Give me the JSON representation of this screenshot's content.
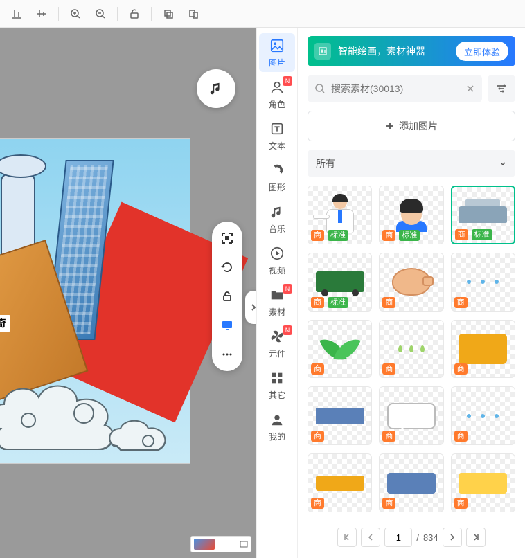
{
  "toolbar": {
    "icons": [
      "align-bottom",
      "align-middle",
      "zoom-in",
      "zoom-out",
      "unlock",
      "copy",
      "paste"
    ]
  },
  "canvas": {
    "caption": "写传奇",
    "music_icon": "music-note",
    "tools": [
      "focus",
      "rotate",
      "lock",
      "display",
      "more"
    ]
  },
  "sidetabs": [
    {
      "key": "image",
      "label": "图片",
      "icon": "image",
      "active": true
    },
    {
      "key": "role",
      "label": "角色",
      "icon": "person",
      "badge": "N"
    },
    {
      "key": "text",
      "label": "文本",
      "icon": "text"
    },
    {
      "key": "shape",
      "label": "图形",
      "icon": "shape"
    },
    {
      "key": "music",
      "label": "音乐",
      "icon": "music"
    },
    {
      "key": "video",
      "label": "视频",
      "icon": "play"
    },
    {
      "key": "material",
      "label": "素材",
      "icon": "folder",
      "badge": "N"
    },
    {
      "key": "component",
      "label": "元件",
      "icon": "pinwheel",
      "badge": "N"
    },
    {
      "key": "other",
      "label": "其它",
      "icon": "grid"
    },
    {
      "key": "mine",
      "label": "我的",
      "icon": "user"
    }
  ],
  "panel": {
    "promo_text": "智能绘画，素材神器",
    "promo_btn": "立即体验",
    "search_placeholder": "搜索素材(30013)",
    "add_label": "添加图片",
    "category_label": "所有",
    "tags": {
      "commercial": "商",
      "standard": "标准"
    },
    "assets": [
      {
        "kind": "doctor",
        "com": true,
        "std": true
      },
      {
        "kind": "head",
        "com": true,
        "std": true
      },
      {
        "kind": "ship",
        "com": true,
        "std": true,
        "selected": true
      },
      {
        "kind": "truck",
        "com": true,
        "std": true
      },
      {
        "kind": "chicken",
        "com": true
      },
      {
        "kind": "dots",
        "com": true
      },
      {
        "kind": "leaf",
        "com": true
      },
      {
        "kind": "drops",
        "com": true
      },
      {
        "kind": "rect",
        "com": true
      },
      {
        "kind": "arrow",
        "com": true
      },
      {
        "kind": "bubble",
        "com": true
      },
      {
        "kind": "dots",
        "com": true
      },
      {
        "kind": "arrow2",
        "com": true
      },
      {
        "kind": "band",
        "com": true
      },
      {
        "kind": "band2",
        "com": true
      }
    ],
    "pager": {
      "current": "1",
      "sep": "/",
      "total": "834"
    }
  }
}
